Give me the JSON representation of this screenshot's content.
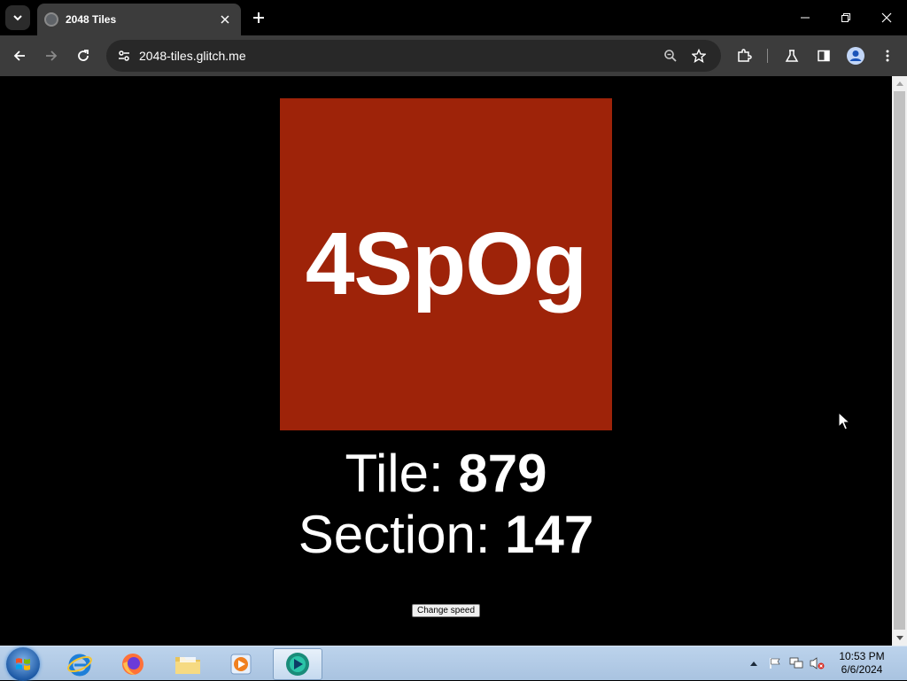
{
  "browser": {
    "tab_title": "2048 Tiles",
    "url": "2048-tiles.glitch.me"
  },
  "page": {
    "tile_text": "4SpOg",
    "tile_color": "#9e2309",
    "tile_label": "Tile: ",
    "tile_value": "879",
    "section_label": "Section: ",
    "section_value": "147",
    "speed_button_label": "Change speed"
  },
  "taskbar": {
    "time": "10:53 PM",
    "date": "6/6/2024"
  },
  "icons": {
    "tab_search": "chevron-down-icon",
    "favicon": "globe-icon",
    "back": "arrow-left-icon",
    "forward": "arrow-right-icon",
    "reload": "reload-icon",
    "site_info": "tune-icon",
    "zoom": "zoom-icon",
    "bookmark": "star-icon",
    "extensions": "puzzle-icon",
    "labs": "flask-icon",
    "side_panel": "side-panel-icon",
    "profile": "profile-icon",
    "menu": "more-vert-icon"
  }
}
